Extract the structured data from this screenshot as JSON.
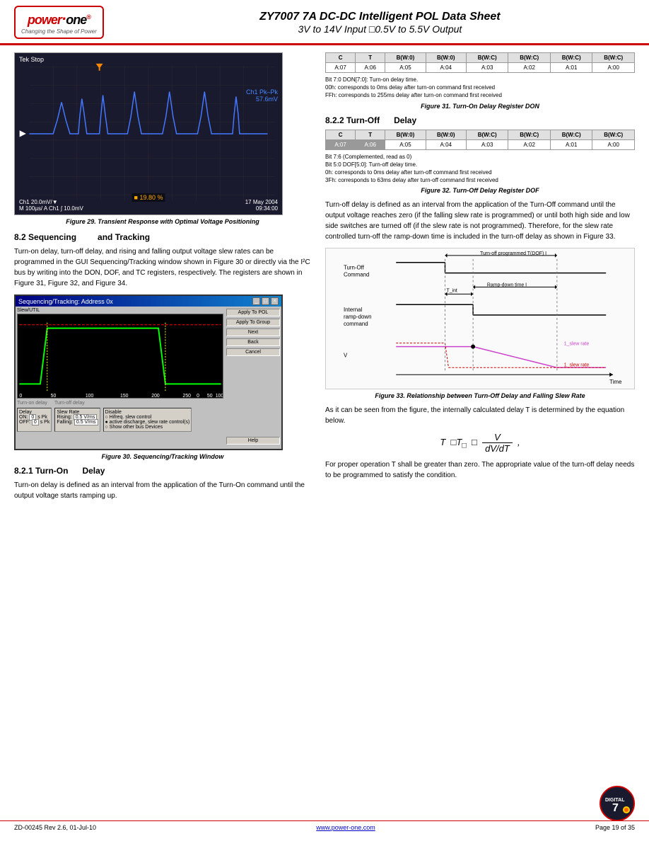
{
  "header": {
    "title_line1": "ZY7007 7A DC-DC Intelligent POL Data Sheet",
    "title_line2": "3V to 14V Input    □0.5V to 5.5V Output",
    "logo_main": "power·one",
    "logo_sub": "Changing the Shape of Power"
  },
  "figures": {
    "fig29_caption": "Figure 29.  Transient Response with Optimal Voltage Positioning",
    "fig30_caption": "Figure 30.  Sequencing/Tracking Window",
    "fig31_caption": "Figure 31.  Turn-On Delay Register DON",
    "fig32_caption": "Figure 32.  Turn-Off Delay Register DOF",
    "fig33_caption": "Figure 33.  Relationship between Turn-Off Delay and Falling Slew Rate"
  },
  "scope": {
    "label_top": "Tek Stop",
    "ch1_pk": "Ch1 Pk–Pk",
    "ch1_val": "57.6mV",
    "bottom_left": "Ch1  20.0mV/▼",
    "bottom_mid": "M 100µs/  A  Ch1  ∫  10.0mV",
    "percentage": "■ 19.80 %",
    "date": "17 May 2004",
    "time": "09:34:00"
  },
  "sections": {
    "s8_2_title": "8.2 Sequencing",
    "s8_2_title2": "and   Tracking",
    "s8_2_text": "Turn-on delay, turn-off delay, and rising and falling output voltage slew rates can be programmed in the GUI Sequencing/Tracking window shown in Figure 30 or directly via the I²C bus by writing into the DON, DOF, and TC registers, respectively.  The registers are shown in Figure 31, Figure 32, and Figure 34.",
    "s8_2_1_title": "8.2.1 Turn-On",
    "s8_2_1_title2": "Delay",
    "s8_2_1_text": "Turn-on delay is defined as an interval from the application of the Turn-On command until the output voltage starts ramping up.",
    "s8_2_2_title": "8.2.2 Turn-Off",
    "s8_2_2_title2": "Delay",
    "s8_2_2_text1": "Turn-off delay is defined as an interval from the application of the Turn-Off command until the output voltage reaches zero (if the falling slew rate is programmed) or until both high side and low side switches are turned off (if the slew rate is not programmed).  Therefore, for the slew rate controlled turn-off the ramp-down time is included in the turn-off delay as shown in Figure 33.",
    "s8_2_2_text2": "As it can be seen from the figure, the internally calculated delay T        is determined by the equation below.",
    "eq_text": "T  □T    □   V  /  dV/dT ,",
    "s8_2_2_text3": "For proper operation T        shall be greater than zero. The appropriate value of the turn-off delay needs to be programmed to satisfy the condition."
  },
  "gui_window": {
    "title": "Sequencing/Tracking: Address 0x",
    "btn_apply_pol": "Apply To POL",
    "btn_apply_group": "Apply To Group",
    "btn_next": "Next",
    "btn_back": "Back",
    "btn_cancel": "Cancel",
    "btn_help": "Help"
  },
  "reg_don": {
    "cols": [
      "C",
      "T",
      "B(W:0)",
      "B(W:0)",
      "B(W:C)",
      "B(W:C)",
      "B(W:C)",
      "B(W:C)"
    ],
    "row1": [
      "A:07",
      "A:06",
      "A:05",
      "A:04",
      "A:03",
      "A:02",
      "A:01",
      "A:00"
    ],
    "notes": [
      "Bit 7:0 DON[7:0]: Turn-on delay time.",
      "00h: corresponds to 0ms delay after turn-on command first received",
      "FFh: corresponds to 255ms delay after turn-on command first received"
    ]
  },
  "reg_dof": {
    "cols": [
      "C",
      "T",
      "B(W:0)",
      "B(W:0)",
      "B(W:C)",
      "B(W:C)",
      "B(W:C)",
      "B(W:C)"
    ],
    "row1_gray": [
      "A:07",
      "A:06"
    ],
    "row1_normal": [
      "A:05",
      "A:04",
      "A:03",
      "A:02",
      "A:01",
      "A:00"
    ],
    "notes": [
      "Bit 7:6 (Complemented, read as 0)",
      "Bit 5:0 DOF[5:0]: Turn-off delay time.",
      "0h: corresponds to 0ms delay after turn-off command first received",
      "3Fh: corresponds to 63ms delay after turn-off command first received"
    ]
  },
  "footer": {
    "left": "ZD-00245 Rev 2.6, 01-Jul-10",
    "center_link": "www.power-one.com",
    "right": "Page 19 of 35"
  },
  "diagram": {
    "turn_off_command": "Turn-Off Command",
    "internal_rampdown": "Internal ramp-down command",
    "v_label": "V",
    "time_label": "Time"
  }
}
